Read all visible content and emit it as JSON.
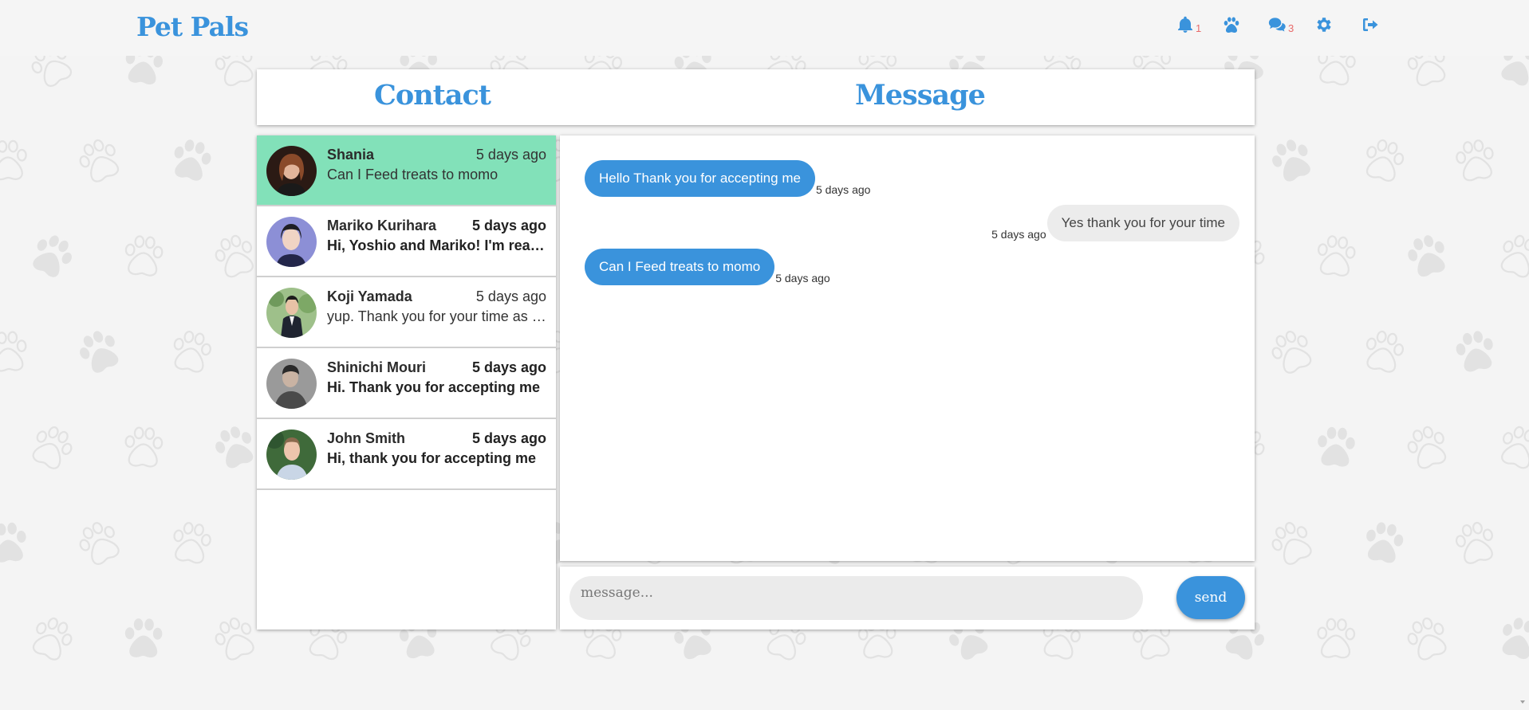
{
  "app": {
    "logo": "Pet Pals"
  },
  "nav": {
    "notifications_count": "1",
    "messages_count": "3",
    "icons": [
      "bell-icon",
      "paw-icon",
      "chat-icon",
      "gear-icon",
      "sign-out-icon"
    ]
  },
  "headers": {
    "contact": "Contact",
    "message": "Message"
  },
  "contacts": [
    {
      "name": "Shania",
      "time": "5 days ago",
      "last_message": "Can I Feed treats to momo",
      "active": true
    },
    {
      "name": "Mariko Kurihara",
      "time": "5 days ago",
      "last_message": "Hi, Yoshio and Mariko! I'm ready",
      "unread": true
    },
    {
      "name": "Koji Yamada",
      "time": "5 days ago",
      "last_message": "yup. Thank you for your time as well"
    },
    {
      "name": "Shinichi Mouri",
      "time": "5 days ago",
      "last_message": "Hi. Thank you for accepting me",
      "unread": true
    },
    {
      "name": "John Smith",
      "time": "5 days ago",
      "last_message": "Hi, thank you for accepting me",
      "unread": true
    }
  ],
  "messages": [
    {
      "text": "Hello Thank you for accepting me",
      "time": "5 days ago",
      "direction": "sent"
    },
    {
      "text": "Yes thank you for your time",
      "time": "5 days ago",
      "direction": "received"
    },
    {
      "text": "Can I Feed treats to momo",
      "time": "5 days ago",
      "direction": "sent"
    }
  ],
  "composer": {
    "placeholder": "message...",
    "send_label": "send"
  },
  "colors": {
    "accent": "#3a93dc",
    "active_contact": "#82e1b9",
    "badge": "#e86a6a"
  }
}
